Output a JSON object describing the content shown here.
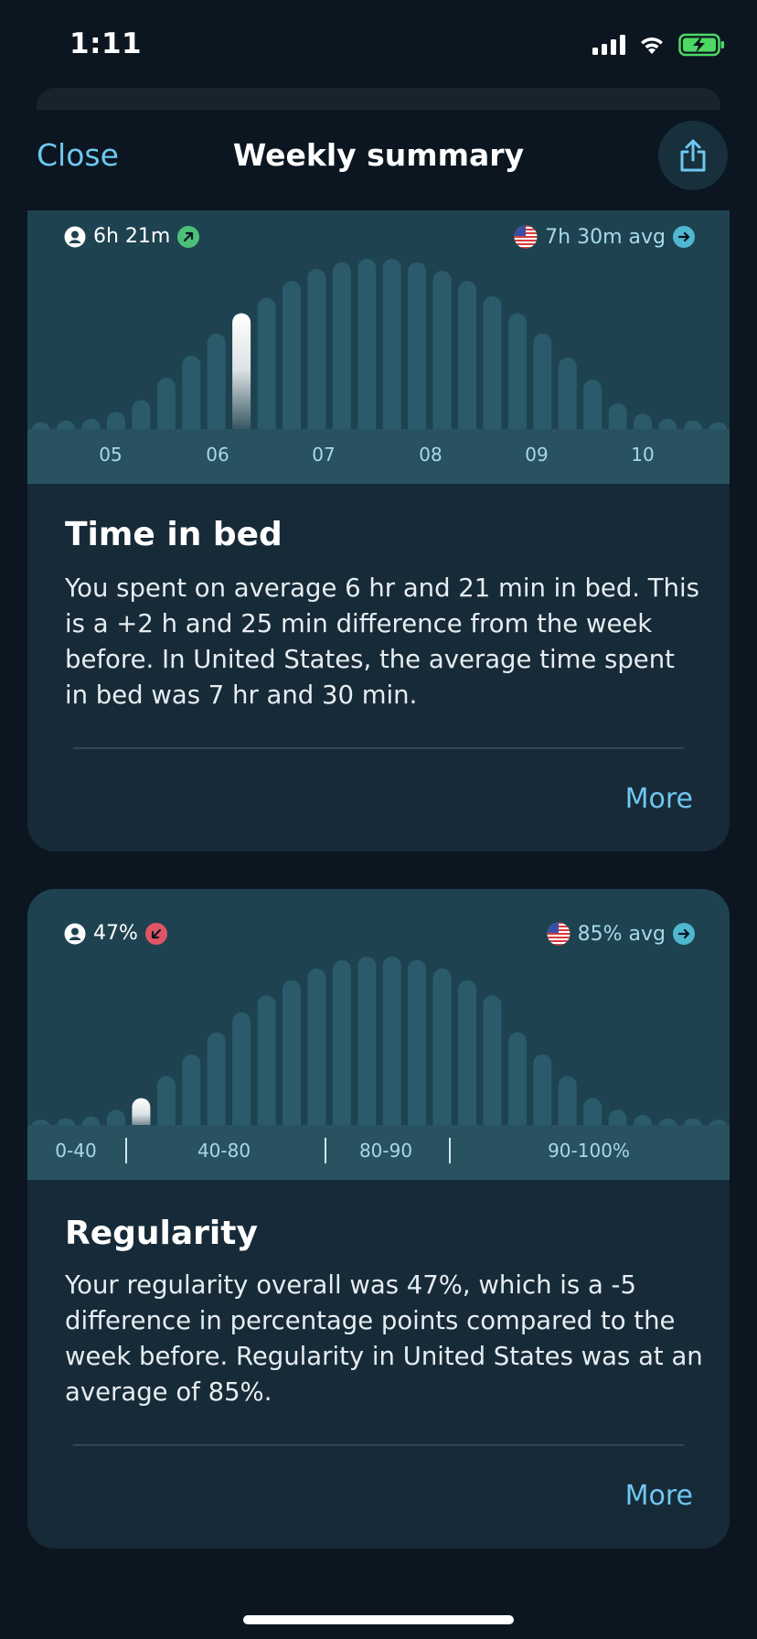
{
  "status_bar": {
    "time": "1:11"
  },
  "nav": {
    "close_label": "Close",
    "title": "Weekly summary"
  },
  "cards": [
    {
      "user_stat": "6h 21m",
      "user_trend": "up",
      "country_stat": "7h 30m avg",
      "country_trend": "right",
      "axis_labels": [
        "05",
        "06",
        "07",
        "08",
        "09",
        "10"
      ],
      "title": "Time in bed",
      "body": "You spent on average 6 hr and 21 min in bed. This is a +2 h and 25 min difference from the week before. In United States, the average time spent in bed was 7 hr and 30 min.",
      "more_label": "More",
      "chart_data": {
        "type": "bar",
        "bar_heights": [
          0.04,
          0.05,
          0.06,
          0.1,
          0.17,
          0.3,
          0.43,
          0.56,
          0.68,
          0.77,
          0.87,
          0.94,
          0.98,
          1.0,
          1.0,
          0.98,
          0.93,
          0.87,
          0.78,
          0.68,
          0.56,
          0.42,
          0.29,
          0.15,
          0.09,
          0.06,
          0.05,
          0.04
        ],
        "highlight_index": 8
      }
    },
    {
      "user_stat": "47%",
      "user_trend": "down",
      "country_stat": "85% avg",
      "country_trend": "right",
      "axis_labels": [
        "0-40",
        "40-80",
        "80-90",
        "90-100%"
      ],
      "title": "Regularity",
      "body": "Your regularity overall was 47%, which is a -5 difference in percentage points compared to the week before. Regularity in United States was at an average of 85%.",
      "more_label": "More",
      "chart_data": {
        "type": "bar",
        "bar_heights": [
          0.03,
          0.04,
          0.05,
          0.09,
          0.16,
          0.29,
          0.42,
          0.55,
          0.67,
          0.77,
          0.86,
          0.93,
          0.98,
          1.0,
          1.0,
          0.98,
          0.93,
          0.86,
          0.77,
          0.55,
          0.42,
          0.29,
          0.16,
          0.09,
          0.06,
          0.04,
          0.04,
          0.03
        ],
        "highlight_index": 4
      }
    }
  ],
  "colors": {
    "accent": "#6ec7f0",
    "bar": "#2b5b6a",
    "highlight": "#ffffff",
    "trend_up": "#4cc07a",
    "trend_down": "#e05566",
    "trend_neutral": "#4fb7cf"
  }
}
